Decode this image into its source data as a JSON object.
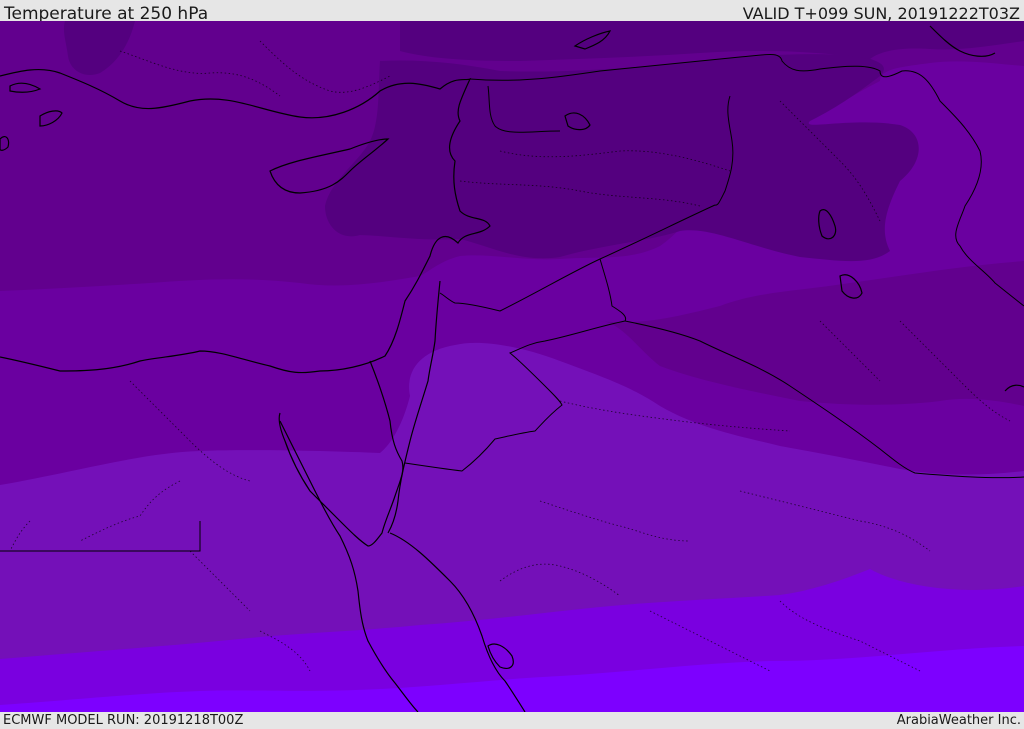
{
  "header": {
    "title": "Temperature at 250 hPa",
    "valid_time": "VALID T+099 SUN, 20191222T03Z"
  },
  "footer": {
    "model_run": "ECMWF MODEL RUN: 20191218T00Z",
    "credit": "ArabiaWeather Inc."
  },
  "colors": {
    "coldest": "#54007f",
    "cold": "#62008e",
    "mid": "#6a00a0",
    "mild": "#7410b8",
    "warm": "#7a00e0",
    "warmest": "#7d00ff",
    "coastline": "#000000",
    "border": "#000000"
  }
}
